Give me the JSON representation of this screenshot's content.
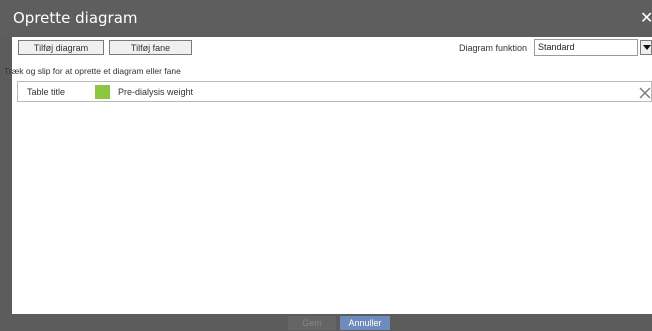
{
  "dialog": {
    "title": "Oprette diagram",
    "close_icon": "close-icon"
  },
  "toolbar": {
    "add_chart_label": "Tilføj diagram",
    "add_tab_label": "Tilføj fane",
    "function_label": "Diagram funktion",
    "function_value": "Standard",
    "dropdown_icon": "caret-down-icon"
  },
  "hint": "Træk og slip for at oprette et diagram eller fane",
  "rows": [
    {
      "title": "Table title",
      "series_label": "Pre-dialysis weight",
      "series_color": "#8dc63f",
      "remove_icon": "close-icon"
    }
  ],
  "footer": {
    "save_label": "Gem",
    "cancel_label": "Annuller"
  },
  "colors": {
    "window_chrome": "#5e5e5e",
    "content_background": "#ffffff",
    "cancel_button": "#6d8bbc",
    "save_button_disabled": "#656565"
  }
}
